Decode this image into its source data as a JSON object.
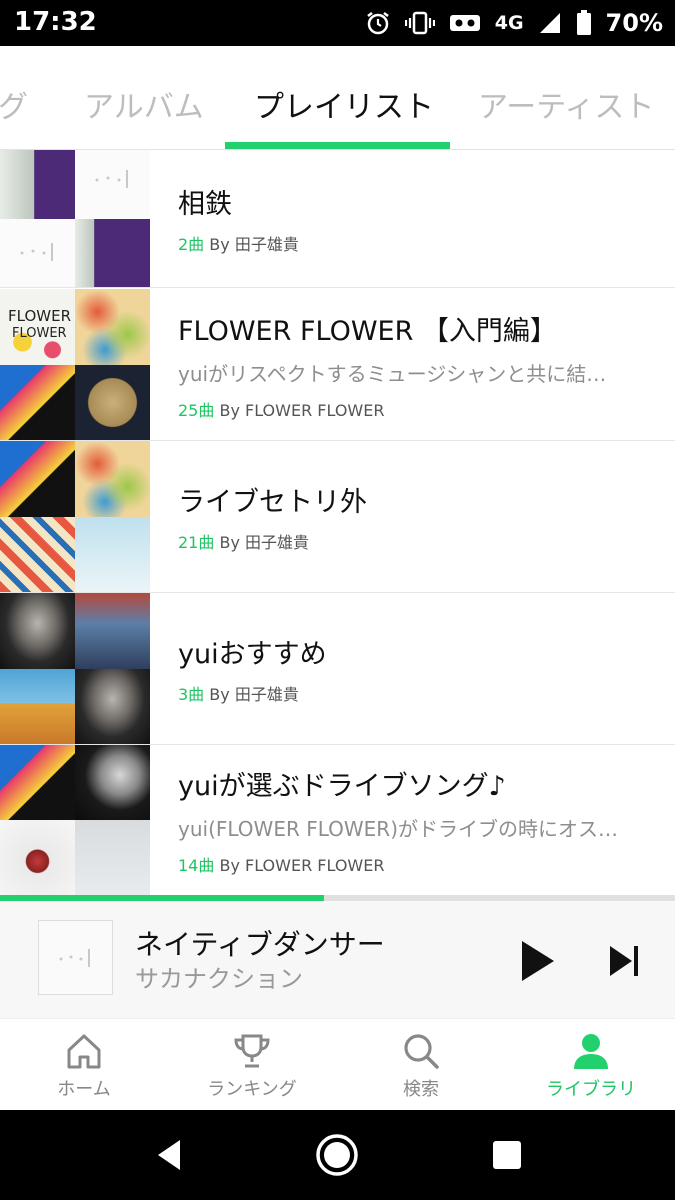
{
  "status_bar": {
    "time": "17:32",
    "network": "4G",
    "battery": "70%"
  },
  "tabs": [
    {
      "label": "グ"
    },
    {
      "label": "アルバム"
    },
    {
      "label": "プレイリスト",
      "active": true
    },
    {
      "label": "アーティスト"
    }
  ],
  "playlists": [
    {
      "title": "相鉄",
      "description": "",
      "count": "2曲",
      "by": "By 田子雄貴"
    },
    {
      "title": "FLOWER FLOWER 【入門編】",
      "description": "yuiがリスペクトするミュージシャンと共に結…",
      "count": "25曲",
      "by": "By FLOWER FLOWER"
    },
    {
      "title": "ライブセトリ外",
      "description": "",
      "count": "21曲",
      "by": "By 田子雄貴"
    },
    {
      "title": "yuiおすすめ",
      "description": "",
      "count": "3曲",
      "by": "By 田子雄貴"
    },
    {
      "title": "yuiが選ぶドライブソング♪",
      "description": "yui(FLOWER FLOWER)がドライブの時にオス…",
      "count": "14曲",
      "by": "By FLOWER FLOWER"
    }
  ],
  "now_playing": {
    "song": "ネイティブダンサー",
    "artist": "サカナクション",
    "progress": 0.48
  },
  "bottom_nav": [
    {
      "label": "ホーム",
      "icon": "home-icon"
    },
    {
      "label": "ランキング",
      "icon": "trophy-icon"
    },
    {
      "label": "検索",
      "icon": "search-icon"
    },
    {
      "label": "ライブラリ",
      "icon": "person-icon",
      "active": true
    }
  ],
  "colors": {
    "accent": "#22d16d",
    "accent_text": "#1fc463"
  }
}
